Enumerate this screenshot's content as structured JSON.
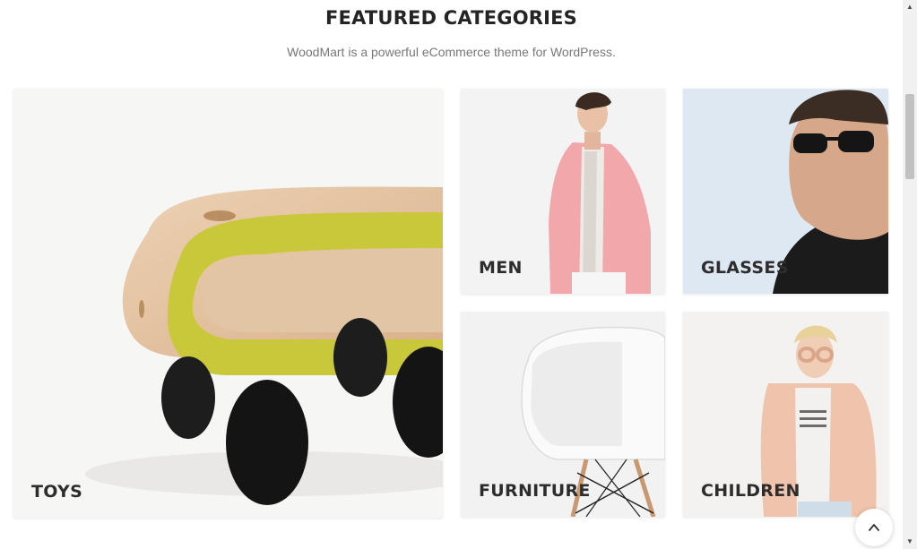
{
  "section": {
    "title": "FEATURED CATEGORIES",
    "subtitle": "WoodMart is a powerful eCommerce theme for WordPress."
  },
  "categories": [
    {
      "label": "TOYS",
      "image": "wooden-toy-car"
    },
    {
      "label": "MEN",
      "image": "man-in-pink-blazer"
    },
    {
      "label": "GLASSES",
      "image": "man-wearing-sunglasses"
    },
    {
      "label": "FURNITURE",
      "image": "white-eames-chair"
    },
    {
      "label": "CHILDREN",
      "image": "child-in-pink-jacket"
    }
  ],
  "icons": {
    "back_to_top": "chevron-up-icon"
  },
  "colors": {
    "title": "#242424",
    "subtitle": "#777777",
    "label": "#2d2d2d",
    "toy_accent": "#c9c83a"
  }
}
